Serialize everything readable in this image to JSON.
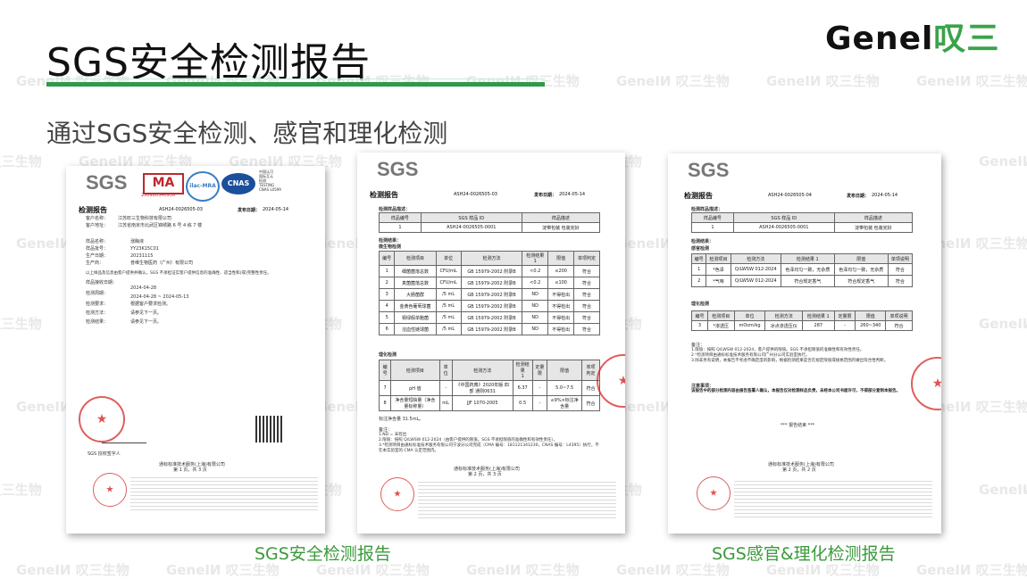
{
  "header": {
    "title": "SGS安全检测报告",
    "subtitle": "通过SGS安全检测、感官和理化检测",
    "logo_en": "Genel",
    "logo_cn": "叹三"
  },
  "watermark": "GeneIИ 叹三生物",
  "doc1": {
    "sgs": "SGS",
    "ma_label": "MA",
    "ma_number": "230920340938",
    "ilac": "ilac-MRA",
    "cnas": "CNAS",
    "cnas_side": "中国认可\n国际互认\n检测\nTESTING\nCNAS L0599",
    "report_title": "检测报告",
    "report_no": "ASH24-0026505-03",
    "date_label": "发布日期：",
    "date": "2024-05-14",
    "client_label": "客户名称：",
    "client": "江苏叹三生物科技有限公司",
    "address_label": "客户地址：",
    "address": "江苏省南京市北武区锦绣路 6 号 4 栋 7 楼",
    "sample_label": "样品名称：",
    "sample": "涨酶液",
    "batch_label": "样品批号：",
    "batch": "YY23K15C01",
    "prod_label": "生产日期：",
    "prod": "20231115",
    "maker_label": "生产商：",
    "maker": "普维生物医药（广州）有限公司",
    "note": "以上样品及信息由客户提供并确认，SGS 不承担证实客户提供信息的准确性、适当性和(或)完整性责任。",
    "recv_label": "样品接收日期：",
    "recv": "2024-04-28",
    "period_label": "检测周期：",
    "period": "2024-04-28 ~ 2024-05-13",
    "req_label": "检测要求：",
    "req": "根据客户要求检测。",
    "method_label": "检测方法：",
    "method": "请参见下一页。",
    "result_label": "检测结果：",
    "result": "请参见下一页。",
    "signer": "SGS 授权签字人",
    "company": "通标标准技术服务(上海)有限公司",
    "page": "第 1 页，共 3 页"
  },
  "doc2": {
    "sgs": "SGS",
    "report_title": "检测报告",
    "report_no": "ASH24-0026505-03",
    "date_label": "发布日期：",
    "date": "2024-05-14",
    "desc_label": "检测样品描述：",
    "desc_headers": [
      "样品编号",
      "SGS 样品 ID",
      "样品描述"
    ],
    "desc_row": [
      "1",
      "ASH24-0026505-0001",
      "淀带包装 包装完好"
    ],
    "results_label": "检测结果：",
    "micro_label": "微生物检测",
    "micro_headers": [
      "编号",
      "检测项目",
      "单位",
      "检测方法",
      "检测结果\n1",
      "限值",
      "单项判定"
    ],
    "micro_rows": [
      [
        "1",
        "细菌菌落总数",
        "CFU/mL",
        "GB 15979-2002 附录B",
        "<0.2",
        "≤200",
        "符合"
      ],
      [
        "2",
        "真菌菌落总数",
        "CFU/mL",
        "GB 15979-2002 附录B",
        "<0.2",
        "≤100",
        "符合"
      ],
      [
        "3",
        "大肠菌群",
        "/5 mL",
        "GB 15979-2002 附录B",
        "ND",
        "不得检出",
        "符合"
      ],
      [
        "4",
        "金黄色葡萄球菌",
        "/5 mL",
        "GB 15979-2002 附录B",
        "ND",
        "不得检出",
        "符合"
      ],
      [
        "5",
        "铜绿假单胞菌",
        "/5 mL",
        "GB 15979-2002 附录B",
        "ND",
        "不得检出",
        "符合"
      ],
      [
        "6",
        "溶血性链球菌",
        "/5 mL",
        "GB 15979-2002 附录B",
        "ND",
        "不得检出",
        "符合"
      ]
    ],
    "chem_label": "理化检测",
    "chem_headers": [
      "编号",
      "检测项目",
      "单位",
      "检测方法",
      "检测结果\n1",
      "定量限",
      "限值",
      "单项判定"
    ],
    "chem_rows": [
      [
        "7",
        "pH 值",
        "-",
        "《中国药典》2020年版 四部 通则0631",
        "6.37",
        "-",
        "5.0~7.5",
        "符合"
      ],
      [
        "8",
        "净含量短缺量（净含量标称量）",
        "mL",
        "JJF 1070-2005",
        "0.5",
        "-",
        "≤9%×标注净含量",
        "符合"
      ]
    ],
    "note_net": "标注净含量 31.5mL。",
    "notes_title": "备注：",
    "notes": [
      "1.ND = 未检出",
      "2.限值：按照 Q/LWSW 012-2024（由客户提供的限值。SGS 不承担限值的准确性和有效性责任）。",
      "3.*检测项目由通标标准技术服务有限公司宁波分公司完成（CMA 编号：181121341230，CNAS 编号：L4395）执行，不在本实验室的 CMA 认定范围内。"
    ],
    "company": "通标标准技术服务(上海)有限公司",
    "page": "第 2 页，共 3 页"
  },
  "doc3": {
    "sgs": "SGS",
    "report_title": "检测报告",
    "report_no": "ASH24-0026505-04",
    "date_label": "发布日期：",
    "date": "2024-05-14",
    "desc_label": "检测样品描述：",
    "desc_headers": [
      "样品编号",
      "SGS 样品 ID",
      "样品描述"
    ],
    "desc_row": [
      "1",
      "ASH24-0026505-0001",
      "淀带包装 包装完好"
    ],
    "results_label": "检测结果：",
    "sense_label": "感官检测",
    "sense_headers": [
      "编号",
      "检测项目",
      "检测方法",
      "检测结果 1",
      "限值",
      "单项说明"
    ],
    "sense_rows": [
      [
        "1",
        "*色泽",
        "Q/LWSW 012-2024",
        "色泽均匀一致，无杂质",
        "色泽均匀一致，无杂质",
        "符合"
      ],
      [
        "2",
        "*气味",
        "Q/LWSW 012-2024",
        "符合规定香气",
        "符合规定香气",
        "符合"
      ]
    ],
    "phys_label": "理化检测",
    "phys_headers": [
      "编号",
      "检测项目",
      "单位",
      "检测方法",
      "检测结果 1",
      "定量限",
      "限值",
      "单项说明"
    ],
    "phys_rows": [
      [
        "3",
        "*渗透压",
        "mOsm/kg",
        "冰点渗透压仪",
        "287",
        "-",
        "260~340",
        "符合"
      ]
    ],
    "notes_title": "备注：",
    "notes": [
      "1.限值：按照 Q/LWSW 012-2024，客户提供的限值。SGS 不承担限值的准确性和有效性责任。",
      "2.*检测项目由通标标准技术服务有限公司广州分公司实验室执行。",
      "3.除非另有说明，本报告不考虑不确定度的影响，根据检测结果是否在规定限值或规格范围内做出符合性判断。"
    ],
    "declare_title": "注意事项：",
    "declare": "该报告中的部分检测内容由报告签署人确认，本报告仅对检测样品负责，未经本公司书面许可，不得部分复制本报告。",
    "end_mark": "*** 报告结束 ***",
    "company": "通标标准技术服务(上海)有限公司",
    "page": "第 2 页，共 2 页"
  },
  "captions": {
    "left": "SGS安全检测报告",
    "right": "SGS感官&理化检测报告"
  },
  "colors": {
    "accent_green": "#2e9a4a",
    "caption_green": "#3a9a3a",
    "stamp_red": "#d62828"
  }
}
